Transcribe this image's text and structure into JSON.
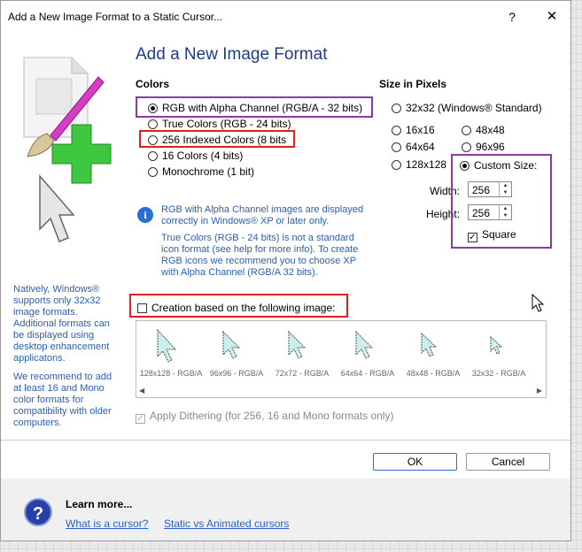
{
  "window": {
    "title": "Add a New Image Format to a Static Cursor...",
    "help_glyph": "?",
    "close_glyph": "✕"
  },
  "heading": "Add a New Image Format",
  "colors": {
    "label": "Colors",
    "options": [
      {
        "label": "RGB with Alpha Channel (RGB/A - 32 bits)",
        "selected": true
      },
      {
        "label": "True Colors (RGB - 24 bits)",
        "selected": false
      },
      {
        "label": "256 Indexed Colors (8 bits",
        "selected": false
      },
      {
        "label": "16 Colors (4 bits)",
        "selected": false
      },
      {
        "label": "Monochrome (1 bit)",
        "selected": false
      }
    ]
  },
  "size": {
    "label": "Size in Pixels",
    "opt_32": "32x32 (Windows® Standard)",
    "opt_16": "16x16",
    "opt_48": "48x48",
    "opt_64": "64x64",
    "opt_96": "96x96",
    "opt_128": "128x128",
    "custom": "Custom Size:",
    "width_label": "Width:",
    "width_value": "256",
    "height_label": "Height:",
    "height_value": "256",
    "square_label": "Square"
  },
  "info": {
    "text1": "RGB with Alpha Channel images are displayed correctly in Windows® XP or later only.",
    "text2": "True Colors (RGB - 24 bits) is not a standard icon format (see help for more info). To create RGB icons we recommend you to choose XP with Alpha Channel (RGB/A 32 bits)."
  },
  "side": {
    "text1": "Natively, Windows® supports only 32x32 image formats. Additional formats can be displayed using desktop enhancement applicatons.",
    "text2": "We recommend to add at least 16 and Mono color formats for compatibility with older computers."
  },
  "creation": {
    "label": "Creation based on the following image:",
    "thumbs": [
      "128x128 - RGB/A",
      "96x96 - RGB/A",
      "72x72 - RGB/A",
      "64x64 - RGB/A",
      "48x48 - RGB/A",
      "32x32 - RGB/A"
    ]
  },
  "dither": {
    "label": "Apply Dithering (for 256, 16 and Mono formats only)",
    "check_glyph": "✓"
  },
  "buttons": {
    "ok": "OK",
    "cancel": "Cancel"
  },
  "footer": {
    "learn_more": "Learn more...",
    "help_glyph": "?",
    "link1": "What is a cursor?",
    "link2": "Static vs Animated cursors"
  },
  "glyphs": {
    "check": "✓",
    "up": "▲",
    "down": "▼",
    "left": "◀",
    "right": "▶",
    "info": "i"
  },
  "colors_theme": {
    "accent": "#1f3c88",
    "link": "#2a5fd0",
    "red_box": "#e02020",
    "purple_box": "#8b3aa8"
  }
}
